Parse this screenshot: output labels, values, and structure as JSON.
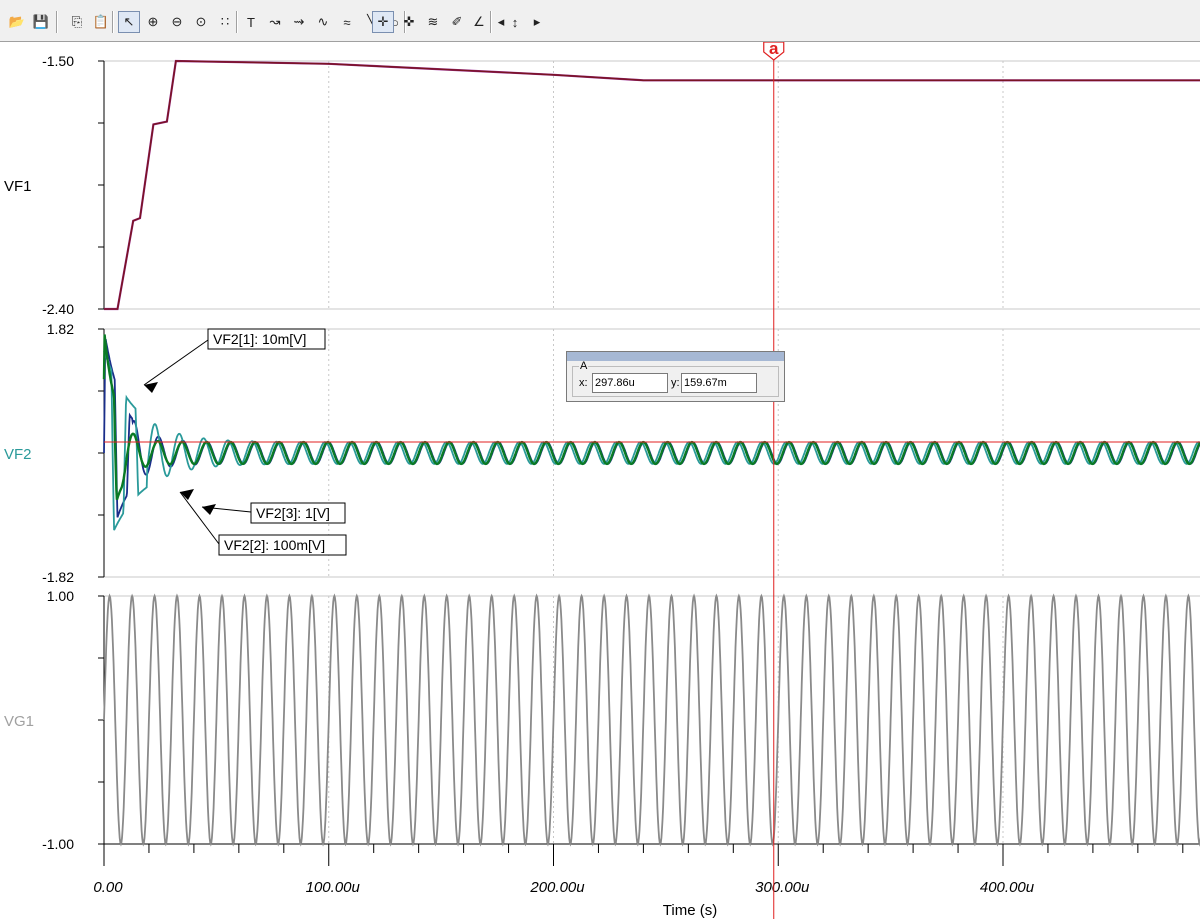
{
  "toolbar": {
    "buttons": [
      "open-folder-icon",
      "save-icon",
      "copy-icon",
      "paste-icon",
      "pointer-icon",
      "zoom-in-icon",
      "zoom-out-icon",
      "zoom-100-icon",
      "grid-icon",
      "text-icon",
      "trace-icon",
      "trace-alt-icon",
      "curve-icon",
      "formula-icon",
      "line-icon",
      "ellipse-icon",
      "cursor-a-icon",
      "cursor-b-icon",
      "curves-icon",
      "probe-icon",
      "angle-icon",
      "arrow-left-icon",
      "arrow-updown-icon",
      "arrow-right-icon"
    ]
  },
  "cursor": {
    "marker_label": "a",
    "panel_title": "A",
    "x_label": "x:",
    "x_value": "297.86u",
    "y_label": "y:",
    "y_value": "159.67m"
  },
  "colors": {
    "vf1": "#7a1424",
    "vf1_magenta": "#9b2a9b",
    "vf2_green": "#0a7a24",
    "vf2_navy": "#1a2e8a",
    "vf2_teal": "#2a9a9a",
    "vg1": "#8a8a8a",
    "cursor": "#e02020",
    "grid": "#c8c8c8"
  },
  "chart_data": [
    {
      "type": "line",
      "name_label": "VF1",
      "ylim": [
        -2.4,
        -1.5
      ],
      "ytick_labels": [
        "-1.50",
        "-2.40"
      ],
      "x": [
        0,
        6,
        13,
        16,
        22,
        28,
        32,
        100,
        200,
        240,
        300,
        488
      ],
      "series": [
        {
          "values": [
            -2.4,
            -2.4,
            -2.08,
            -2.07,
            -1.73,
            -1.72,
            -1.5,
            -1.51,
            -1.55,
            -1.57,
            -1.57,
            -1.57
          ]
        }
      ]
    },
    {
      "type": "line",
      "name_label": "VF2",
      "ylim": [
        -1.82,
        1.82
      ],
      "ytick_labels": [
        "1.82",
        "-1.82"
      ],
      "annotations": [
        "VF2[1]: 10m[V]",
        "VF2[2]: 100m[V]",
        "VF2[3]: 1[V]"
      ],
      "series": [
        {
          "label": "VF2[1]: 10m[V]",
          "amplitude_start": 1.82,
          "settled_amplitude": 0.16,
          "period_us": 10.8
        },
        {
          "label": "VF2[2]: 100m[V]",
          "amplitude_start": 1.6,
          "settled_amplitude": 0.16,
          "period_us": 10.8
        },
        {
          "label": "VF2[3]: 1[V]",
          "amplitude_start": 1.1,
          "settled_amplitude": 0.16,
          "period_us": 10.8
        }
      ]
    },
    {
      "type": "line",
      "name_label": "VG1",
      "ylim": [
        -1.0,
        1.0
      ],
      "ytick_labels": [
        "1.00",
        "-1.00"
      ],
      "series": [
        {
          "amplitude": 1.0,
          "period_us": 10.0
        }
      ]
    }
  ],
  "x_axis": {
    "title": "Time (s)",
    "ticks": [
      0,
      100,
      200,
      300,
      400
    ],
    "tick_labels": [
      "0.00",
      "100.00u",
      "200.00u",
      "300.00u",
      "400.00u"
    ],
    "xlim": [
      0,
      488
    ],
    "cursor_x": 298
  }
}
